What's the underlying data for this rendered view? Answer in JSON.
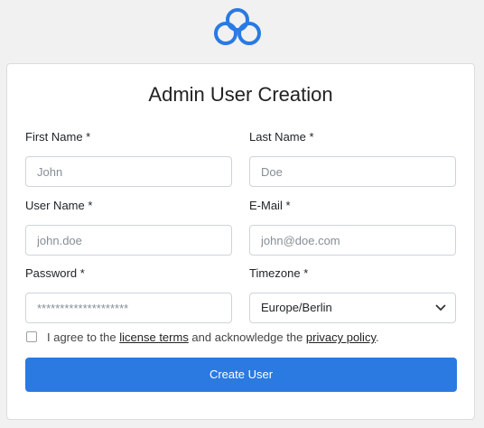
{
  "header": {
    "logo_icon": "cloud-icon",
    "accent": "#2a7ae2"
  },
  "form": {
    "title": "Admin User Creation",
    "first_name": {
      "label": "First Name *",
      "placeholder": "John"
    },
    "last_name": {
      "label": "Last Name *",
      "placeholder": "Doe"
    },
    "user_name": {
      "label": "User Name *",
      "placeholder": "john.doe"
    },
    "email": {
      "label": "E-Mail *",
      "placeholder": "john@doe.com"
    },
    "password": {
      "label": "Password *",
      "placeholder": "********************"
    },
    "timezone": {
      "label": "Timezone *",
      "value": "Europe/Berlin",
      "icon": "chevron-down-icon"
    },
    "agree": {
      "prefix": "I agree to the ",
      "license_link": "license terms",
      "middle": " and acknowledge the ",
      "privacy_link": "privacy policy",
      "suffix": "."
    },
    "submit_label": "Create User"
  }
}
